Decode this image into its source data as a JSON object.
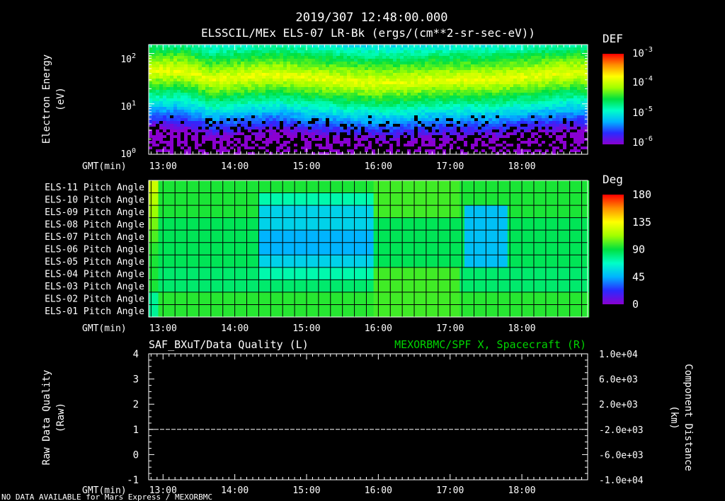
{
  "header": {
    "timestamp": "2019/307 12:48:00.000",
    "title": "ELSSCIL/MEx ELS-07 LR-Bk  (ergs/(cm**2-sr-sec-eV))"
  },
  "colors": {
    "background": "#000000",
    "foreground": "#ffffff",
    "right_series": "#00d400",
    "colorbar_stops": [
      "#8a00d0",
      "#2a2aff",
      "#00b4ff",
      "#00ffc8",
      "#00e040",
      "#a0ff00",
      "#ffff00",
      "#ff9000",
      "#ff0000"
    ]
  },
  "time_axis": {
    "label": "GMT(min)",
    "ticks": [
      "13:00",
      "14:00",
      "15:00",
      "16:00",
      "17:00",
      "18:00"
    ]
  },
  "footer": {
    "note": "NO DATA AVAILABLE for Mars Express / MEXORBMC"
  },
  "chart_data": [
    {
      "type": "heatmap",
      "panel": "spectrogram",
      "ylabel": "Electron Energy",
      "yunit": "(eV)",
      "y_scale": "log",
      "ylim": [
        1,
        150
      ],
      "y_ticks": [
        "10^0",
        "10^1",
        "10^2"
      ],
      "xlim": [
        "12:48",
        "18:55"
      ],
      "colorbar": {
        "title": "DEF",
        "scale": "log",
        "range": [
          1e-06,
          0.001
        ],
        "ticks": [
          "10^-6",
          "10^-5",
          "10^-4",
          "10^-3"
        ]
      },
      "peak_band_energy_eV": {
        "times": [
          "12:48",
          "13:15",
          "13:40",
          "14:30",
          "15:30",
          "16:10",
          "16:50",
          "17:30",
          "18:00",
          "18:30",
          "18:55"
        ],
        "values": [
          45,
          45,
          30,
          38,
          28,
          26,
          30,
          30,
          34,
          40,
          42
        ]
      },
      "grid": false
    },
    {
      "type": "heatmap",
      "panel": "pitch_angle",
      "rows": [
        "ELS-11 Pitch Angle",
        "ELS-10 Pitch Angle",
        "ELS-09 Pitch Angle",
        "ELS-08 Pitch Angle",
        "ELS-07 Pitch Angle",
        "ELS-06 Pitch Angle",
        "ELS-05 Pitch Angle",
        "ELS-04 Pitch Angle",
        "ELS-03 Pitch Angle",
        "ELS-02 Pitch Angle",
        "ELS-01 Pitch Angle"
      ],
      "xlim": [
        "12:48",
        "18:55"
      ],
      "colorbar": {
        "title": "Deg",
        "range": [
          0,
          180
        ],
        "ticks": [
          "180",
          "135",
          "90",
          "45",
          "0"
        ]
      },
      "grid": true
    },
    {
      "type": "line",
      "panel": "data_quality",
      "left_title": "SAF_BXuT/Data Quality (L)",
      "right_title": "MEXORBMC/SPF X, Spacecraft (R)",
      "left_ylabel": "Raw Data Quality",
      "left_yunit": "(Raw)",
      "left_ylim": [
        -1,
        4
      ],
      "left_ticks": [
        "4",
        "3",
        "2",
        "1",
        "0",
        "-1"
      ],
      "right_ylabel": "Component Distance",
      "right_yunit": "(km)",
      "right_ylim": [
        -10000,
        10000
      ],
      "right_ticks": [
        "1.0e+04",
        "6.0e+03",
        "2.0e+03",
        "-2.0e+03",
        "-6.0e+03",
        "-1.0e+04"
      ],
      "series": [
        {
          "x": [
            "12:48",
            "18:55"
          ],
          "values": [
            1,
            1
          ]
        }
      ]
    }
  ]
}
